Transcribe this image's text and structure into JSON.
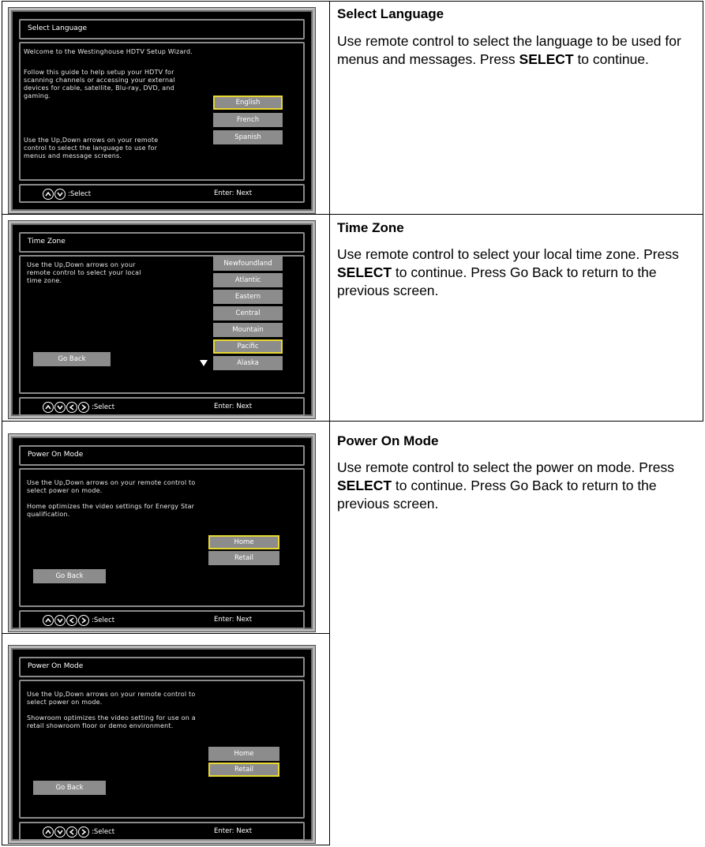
{
  "rows": [
    {
      "heading": "Select Language",
      "desc_parts": [
        "Use remote control to select the language to be used for menus and messages. Press ",
        "SELECT",
        " to continue."
      ],
      "screen": {
        "title": "Select Language",
        "intro": "Welcome to the Westinghouse HDTV Setup Wizard.",
        "guide": "Follow this guide to help setup your HDTV for\nscanning channels or accessing your external\ndevices for cable, satellite, Blu-ray, DVD, and\ngaming.",
        "instruction": "Use the Up,Down arrows on your remote\ncontrol to select the language to use for\nmenus and message screens.",
        "options": [
          "English",
          "French",
          "Spanish"
        ],
        "selected": "English",
        "footer_select": ":Select",
        "footer_next": "Enter: Next"
      }
    },
    {
      "heading": "Time Zone",
      "desc_parts": [
        "Use remote control to select your local time zone. Press ",
        "SELECT",
        " to continue. Press Go Back to return to the previous screen."
      ],
      "screen": {
        "title": "Time Zone",
        "instruction": "Use the Up,Down arrows on your\nremote control to select your local\ntime zone.",
        "options": [
          "Newfoundland",
          "Atlantic",
          "Eastern",
          "Central",
          "Mountain",
          "Pacific",
          "Alaska"
        ],
        "selected": "Pacific",
        "go_back": "Go Back",
        "footer_select": ":Select",
        "footer_next": "Enter: Next"
      }
    },
    {
      "heading": "Power On Mode",
      "desc_parts": [
        "Use remote control to select the power on mode. Press ",
        "SELECT",
        " to continue. Press Go Back to return to the previous screen."
      ],
      "screen": {
        "title": "Power On Mode",
        "instruction": "Use the Up,Down arrows on your remote control to\nselect power on mode.",
        "info": "Home optimizes the video settings for Energy Star\nqualification.",
        "options": [
          "Home",
          "Retail"
        ],
        "selected": "Home",
        "go_back": "Go Back",
        "footer_select": ":Select",
        "footer_next": "Enter: Next"
      }
    },
    {
      "screen": {
        "title": "Power On Mode",
        "instruction": "Use the Up,Down arrows on your remote control to\nselect power on mode.",
        "info": "Showroom optimizes the video setting for use on a\nretail showroom floor or demo environment.",
        "options": [
          "Home",
          "Retail"
        ],
        "selected": "Retail",
        "go_back": "Go Back",
        "footer_select": ":Select",
        "footer_next": "Enter: Next"
      }
    }
  ]
}
